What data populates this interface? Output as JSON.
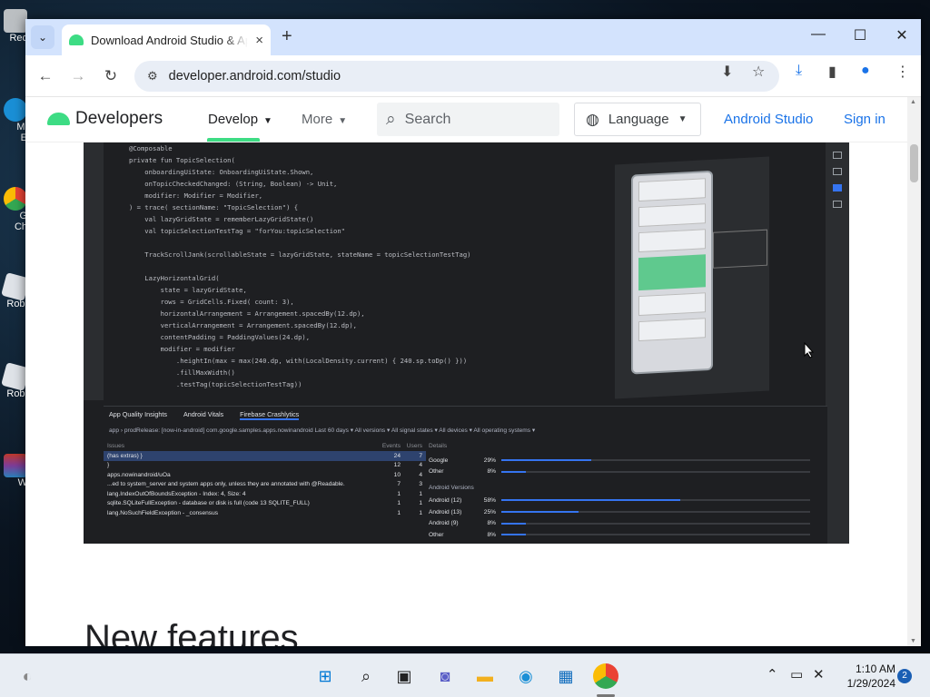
{
  "desktop": {
    "icons": [
      {
        "label": "Rec",
        "name": "recycle-bin"
      },
      {
        "label": "Mi\nE",
        "name": "microsoft-edge"
      },
      {
        "label": "G\nCh",
        "name": "google-chrome"
      },
      {
        "label": "Robl",
        "name": "roblox-player"
      },
      {
        "label": "Robl",
        "name": "roblox-studio"
      },
      {
        "label": "W",
        "name": "winrar"
      }
    ]
  },
  "browser": {
    "tab": {
      "title": "Download Android Studio & Ap",
      "close": "×"
    },
    "new_tab": "+",
    "window_controls": {
      "minimize": "—",
      "maximize": "☐",
      "close": "✕"
    },
    "toolbar": {
      "back": "←",
      "forward": "→",
      "reload": "↻",
      "url": "developer.android.com/studio"
    }
  },
  "site_nav": {
    "logo": "Developers",
    "develop": "Develop",
    "more": "More",
    "search_placeholder": "Search",
    "language": "Language",
    "android_studio": "Android Studio",
    "sign_in": "Sign in"
  },
  "ide": {
    "code_lines": [
      "@Composable",
      "private fun TopicSelection(",
      "    onboardingUiState: OnboardingUiState.Shown,",
      "    onTopicCheckedChanged: (String, Boolean) -> Unit,",
      "    modifier: Modifier = Modifier,",
      ") = trace( sectionName: \"TopicSelection\") {",
      "    val lazyGridState = rememberLazyGridState()",
      "    val topicSelectionTestTag = \"forYou:topicSelection\"",
      "",
      "    TrackScrollJank(scrollableState = lazyGridState, stateName = topicSelectionTestTag)",
      "",
      "    LazyHorizontalGrid(",
      "        state = lazyGridState,",
      "        rows = GridCells.Fixed( count: 3),",
      "        horizontalArrangement = Arrangement.spacedBy(12.dp),",
      "        verticalArrangement = Arrangement.spacedBy(12.dp),",
      "        contentPadding = PaddingValues(24.dp),",
      "        modifier = modifier",
      "            .heightIn(max = max(240.dp, with(LocalDensity.current) { 240.sp.toDp() }))",
      "            .fillMaxWidth()",
      "            .testTag(topicSelectionTestTag))"
    ],
    "aqi_tabs": [
      "App Quality Insights",
      "Android Vitals",
      "Firebase Crashlytics"
    ],
    "aqi_filter": "app › prodRelease: [now-in-android] com.google.samples.apps.nowinandroid    Last 60 days ▾   All versions ▾   All signal states ▾   All devices ▾   All operating systems ▾",
    "issues_header": {
      "name": "Issues",
      "events": "Events",
      "users": "Users"
    },
    "issues": [
      {
        "name": "(has extras) }",
        "events": "24",
        "users": "7"
      },
      {
        "name": "}",
        "events": "12",
        "users": "4"
      },
      {
        "name": "apps.nowinandroid/uOa",
        "events": "10",
        "users": "4"
      },
      {
        "name": "...ed to system_server and system apps only, unless they are annotated with @Readable.",
        "events": "7",
        "users": "3"
      },
      {
        "name": "lang.IndexOutOfBoundsException - Index: 4, Size: 4",
        "events": "1",
        "users": "1"
      },
      {
        "name": "sqlite.SQLiteFullException - database or disk is full (code 13 SQLITE_FULL)",
        "events": "1",
        "users": "1"
      },
      {
        "name": "lang.NoSuchFieldException - _consensus",
        "events": "1",
        "users": "1"
      }
    ],
    "details_header": "Details",
    "details_rows": [
      {
        "label": "Google",
        "pct": "29%",
        "value": 29
      },
      {
        "label": "Other",
        "pct": "8%",
        "value": 8
      }
    ],
    "android_versions_label": "Android Versions",
    "android_versions": [
      {
        "label": "Android (12)",
        "pct": "58%",
        "value": 58
      },
      {
        "label": "Android (13)",
        "pct": "25%",
        "value": 25
      },
      {
        "label": "Android (9)",
        "pct": "8%",
        "value": 8
      },
      {
        "label": "Other",
        "pct": "8%",
        "value": 8
      }
    ]
  },
  "page": {
    "heading": "New features"
  },
  "taskbar": {
    "time": "1:10 AM",
    "date": "1/29/2024",
    "notifications": "2"
  }
}
